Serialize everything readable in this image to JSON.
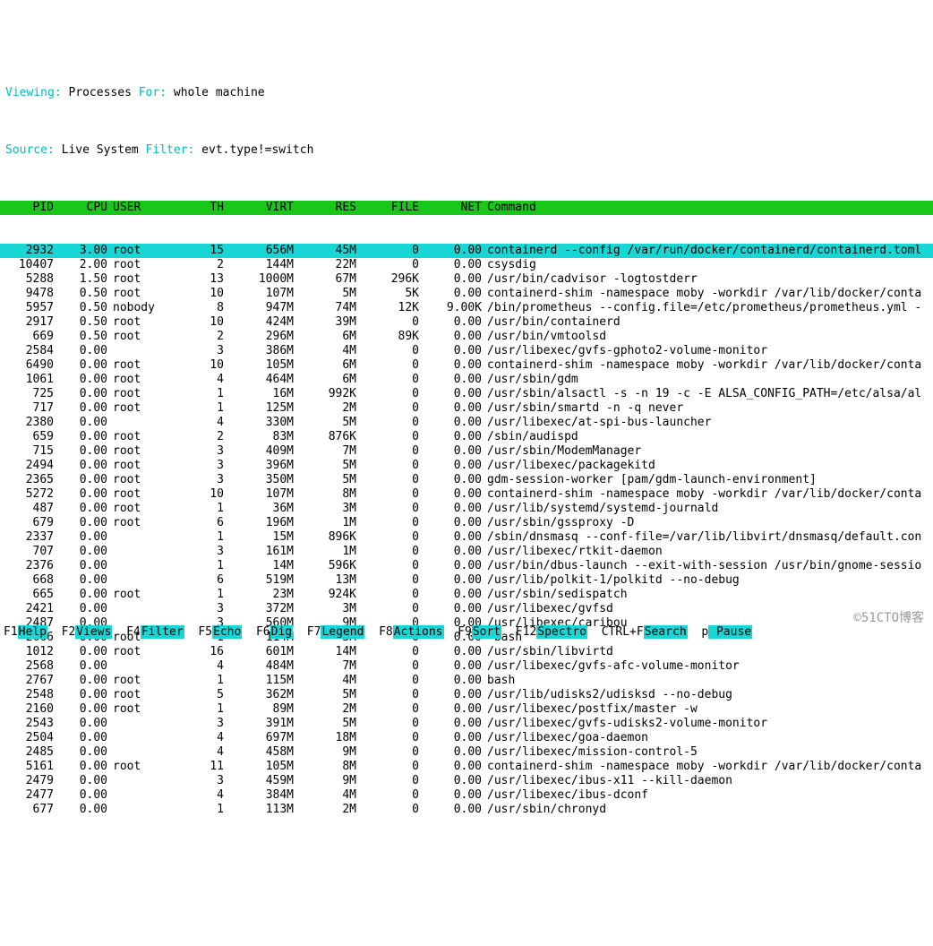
{
  "status": {
    "viewing_key": "Viewing:",
    "viewing_val": "Processes",
    "for_key": "For:",
    "for_val": "whole machine",
    "source_key": "Source:",
    "source_val": "Live System",
    "filter_key": "Filter:",
    "filter_val": "evt.type!=switch"
  },
  "columns": [
    "PID",
    "CPU",
    "USER",
    "TH",
    "VIRT",
    "RES",
    "FILE",
    "NET",
    "Command"
  ],
  "selected_pid": 2932,
  "rows": [
    {
      "pid": 2932,
      "cpu": "3.00",
      "user": "root",
      "th": 15,
      "virt": "656M",
      "res": "45M",
      "file": "0",
      "net": "0.00",
      "cmd": "containerd --config /var/run/docker/containerd/containerd.toml"
    },
    {
      "pid": 10407,
      "cpu": "2.00",
      "user": "root",
      "th": 2,
      "virt": "144M",
      "res": "22M",
      "file": "0",
      "net": "0.00",
      "cmd": "csysdig"
    },
    {
      "pid": 5288,
      "cpu": "1.50",
      "user": "root",
      "th": 13,
      "virt": "1000M",
      "res": "67M",
      "file": "296K",
      "net": "0.00",
      "cmd": "/usr/bin/cadvisor -logtostderr"
    },
    {
      "pid": 9478,
      "cpu": "0.50",
      "user": "root",
      "th": 10,
      "virt": "107M",
      "res": "5M",
      "file": "5K",
      "net": "0.00",
      "cmd": "containerd-shim -namespace moby -workdir /var/lib/docker/conta"
    },
    {
      "pid": 5957,
      "cpu": "0.50",
      "user": "nobody",
      "th": 8,
      "virt": "947M",
      "res": "74M",
      "file": "12K",
      "net": "9.00K",
      "cmd": "/bin/prometheus --config.file=/etc/prometheus/prometheus.yml -"
    },
    {
      "pid": 2917,
      "cpu": "0.50",
      "user": "root",
      "th": 10,
      "virt": "424M",
      "res": "39M",
      "file": "0",
      "net": "0.00",
      "cmd": "/usr/bin/containerd"
    },
    {
      "pid": 669,
      "cpu": "0.50",
      "user": "root",
      "th": 2,
      "virt": "296M",
      "res": "6M",
      "file": "89K",
      "net": "0.00",
      "cmd": "/usr/bin/vmtoolsd"
    },
    {
      "pid": 2584,
      "cpu": "0.00",
      "user": "",
      "th": 3,
      "virt": "386M",
      "res": "4M",
      "file": "0",
      "net": "0.00",
      "cmd": "/usr/libexec/gvfs-gphoto2-volume-monitor"
    },
    {
      "pid": 6490,
      "cpu": "0.00",
      "user": "root",
      "th": 10,
      "virt": "105M",
      "res": "6M",
      "file": "0",
      "net": "0.00",
      "cmd": "containerd-shim -namespace moby -workdir /var/lib/docker/conta"
    },
    {
      "pid": 1061,
      "cpu": "0.00",
      "user": "root",
      "th": 4,
      "virt": "464M",
      "res": "6M",
      "file": "0",
      "net": "0.00",
      "cmd": "/usr/sbin/gdm"
    },
    {
      "pid": 725,
      "cpu": "0.00",
      "user": "root",
      "th": 1,
      "virt": "16M",
      "res": "992K",
      "file": "0",
      "net": "0.00",
      "cmd": "/usr/sbin/alsactl -s -n 19 -c -E ALSA_CONFIG_PATH=/etc/alsa/al"
    },
    {
      "pid": 717,
      "cpu": "0.00",
      "user": "root",
      "th": 1,
      "virt": "125M",
      "res": "2M",
      "file": "0",
      "net": "0.00",
      "cmd": "/usr/sbin/smartd -n -q never"
    },
    {
      "pid": 2380,
      "cpu": "0.00",
      "user": "",
      "th": 4,
      "virt": "330M",
      "res": "5M",
      "file": "0",
      "net": "0.00",
      "cmd": "/usr/libexec/at-spi-bus-launcher"
    },
    {
      "pid": 659,
      "cpu": "0.00",
      "user": "root",
      "th": 2,
      "virt": "83M",
      "res": "876K",
      "file": "0",
      "net": "0.00",
      "cmd": "/sbin/audispd"
    },
    {
      "pid": 715,
      "cpu": "0.00",
      "user": "root",
      "th": 3,
      "virt": "409M",
      "res": "7M",
      "file": "0",
      "net": "0.00",
      "cmd": "/usr/sbin/ModemManager"
    },
    {
      "pid": 2494,
      "cpu": "0.00",
      "user": "root",
      "th": 3,
      "virt": "396M",
      "res": "5M",
      "file": "0",
      "net": "0.00",
      "cmd": "/usr/libexec/packagekitd"
    },
    {
      "pid": 2365,
      "cpu": "0.00",
      "user": "root",
      "th": 3,
      "virt": "350M",
      "res": "5M",
      "file": "0",
      "net": "0.00",
      "cmd": "gdm-session-worker [pam/gdm-launch-environment]"
    },
    {
      "pid": 5272,
      "cpu": "0.00",
      "user": "root",
      "th": 10,
      "virt": "107M",
      "res": "8M",
      "file": "0",
      "net": "0.00",
      "cmd": "containerd-shim -namespace moby -workdir /var/lib/docker/conta"
    },
    {
      "pid": 487,
      "cpu": "0.00",
      "user": "root",
      "th": 1,
      "virt": "36M",
      "res": "3M",
      "file": "0",
      "net": "0.00",
      "cmd": "/usr/lib/systemd/systemd-journald"
    },
    {
      "pid": 679,
      "cpu": "0.00",
      "user": "root",
      "th": 6,
      "virt": "196M",
      "res": "1M",
      "file": "0",
      "net": "0.00",
      "cmd": "/usr/sbin/gssproxy -D"
    },
    {
      "pid": 2337,
      "cpu": "0.00",
      "user": "",
      "th": 1,
      "virt": "15M",
      "res": "896K",
      "file": "0",
      "net": "0.00",
      "cmd": "/sbin/dnsmasq --conf-file=/var/lib/libvirt/dnsmasq/default.con"
    },
    {
      "pid": 707,
      "cpu": "0.00",
      "user": "",
      "th": 3,
      "virt": "161M",
      "res": "1M",
      "file": "0",
      "net": "0.00",
      "cmd": "/usr/libexec/rtkit-daemon"
    },
    {
      "pid": 2376,
      "cpu": "0.00",
      "user": "",
      "th": 1,
      "virt": "14M",
      "res": "596K",
      "file": "0",
      "net": "0.00",
      "cmd": "/usr/bin/dbus-launch --exit-with-session /usr/bin/gnome-sessio"
    },
    {
      "pid": 668,
      "cpu": "0.00",
      "user": "",
      "th": 6,
      "virt": "519M",
      "res": "13M",
      "file": "0",
      "net": "0.00",
      "cmd": "/usr/lib/polkit-1/polkitd --no-debug"
    },
    {
      "pid": 665,
      "cpu": "0.00",
      "user": "root",
      "th": 1,
      "virt": "23M",
      "res": "924K",
      "file": "0",
      "net": "0.00",
      "cmd": "/usr/sbin/sedispatch"
    },
    {
      "pid": 2421,
      "cpu": "0.00",
      "user": "",
      "th": 3,
      "virt": "372M",
      "res": "3M",
      "file": "0",
      "net": "0.00",
      "cmd": "/usr/libexec/gvfsd"
    },
    {
      "pid": 2487,
      "cpu": "0.00",
      "user": "",
      "th": 3,
      "virt": "560M",
      "res": "9M",
      "file": "0",
      "net": "0.00",
      "cmd": "/usr/libexec/caribou"
    },
    {
      "pid": 2666,
      "cpu": "0.00",
      "user": "root",
      "th": 1,
      "virt": "114M",
      "res": "3M",
      "file": "0",
      "net": "0.00",
      "cmd": "-bash"
    },
    {
      "pid": 1012,
      "cpu": "0.00",
      "user": "root",
      "th": 16,
      "virt": "601M",
      "res": "14M",
      "file": "0",
      "net": "0.00",
      "cmd": "/usr/sbin/libvirtd"
    },
    {
      "pid": 2568,
      "cpu": "0.00",
      "user": "",
      "th": 4,
      "virt": "484M",
      "res": "7M",
      "file": "0",
      "net": "0.00",
      "cmd": "/usr/libexec/gvfs-afc-volume-monitor"
    },
    {
      "pid": 2767,
      "cpu": "0.00",
      "user": "root",
      "th": 1,
      "virt": "115M",
      "res": "4M",
      "file": "0",
      "net": "0.00",
      "cmd": "bash"
    },
    {
      "pid": 2548,
      "cpu": "0.00",
      "user": "root",
      "th": 5,
      "virt": "362M",
      "res": "5M",
      "file": "0",
      "net": "0.00",
      "cmd": "/usr/lib/udisks2/udisksd --no-debug"
    },
    {
      "pid": 2160,
      "cpu": "0.00",
      "user": "root",
      "th": 1,
      "virt": "89M",
      "res": "2M",
      "file": "0",
      "net": "0.00",
      "cmd": "/usr/libexec/postfix/master -w"
    },
    {
      "pid": 2543,
      "cpu": "0.00",
      "user": "",
      "th": 3,
      "virt": "391M",
      "res": "5M",
      "file": "0",
      "net": "0.00",
      "cmd": "/usr/libexec/gvfs-udisks2-volume-monitor"
    },
    {
      "pid": 2504,
      "cpu": "0.00",
      "user": "",
      "th": 4,
      "virt": "697M",
      "res": "18M",
      "file": "0",
      "net": "0.00",
      "cmd": "/usr/libexec/goa-daemon"
    },
    {
      "pid": 2485,
      "cpu": "0.00",
      "user": "",
      "th": 4,
      "virt": "458M",
      "res": "9M",
      "file": "0",
      "net": "0.00",
      "cmd": "/usr/libexec/mission-control-5"
    },
    {
      "pid": 5161,
      "cpu": "0.00",
      "user": "root",
      "th": 11,
      "virt": "105M",
      "res": "8M",
      "file": "0",
      "net": "0.00",
      "cmd": "containerd-shim -namespace moby -workdir /var/lib/docker/conta"
    },
    {
      "pid": 2479,
      "cpu": "0.00",
      "user": "",
      "th": 3,
      "virt": "459M",
      "res": "9M",
      "file": "0",
      "net": "0.00",
      "cmd": "/usr/libexec/ibus-x11 --kill-daemon"
    },
    {
      "pid": 2477,
      "cpu": "0.00",
      "user": "",
      "th": 4,
      "virt": "384M",
      "res": "4M",
      "file": "0",
      "net": "0.00",
      "cmd": "/usr/libexec/ibus-dconf"
    },
    {
      "pid": 677,
      "cpu": "0.00",
      "user": "",
      "th": 1,
      "virt": "113M",
      "res": "2M",
      "file": "0",
      "net": "0.00",
      "cmd": "/usr/sbin/chronyd"
    }
  ],
  "fkeys": [
    {
      "key": "F1",
      "label": "Help"
    },
    {
      "key": "F2",
      "label": "Views"
    },
    {
      "key": "F4",
      "label": "Filter"
    },
    {
      "key": "F5",
      "label": "Echo"
    },
    {
      "key": "F6",
      "label": "Dig"
    },
    {
      "key": "F7",
      "label": "Legend"
    },
    {
      "key": "F8",
      "label": "Actions"
    },
    {
      "key": "F9",
      "label": "Sort"
    },
    {
      "key": "F12",
      "label": "Spectro"
    },
    {
      "key": "CTRL+F",
      "label": "Search"
    },
    {
      "key": "p",
      "label": " Pause"
    }
  ],
  "watermark": "©51CTO博客"
}
